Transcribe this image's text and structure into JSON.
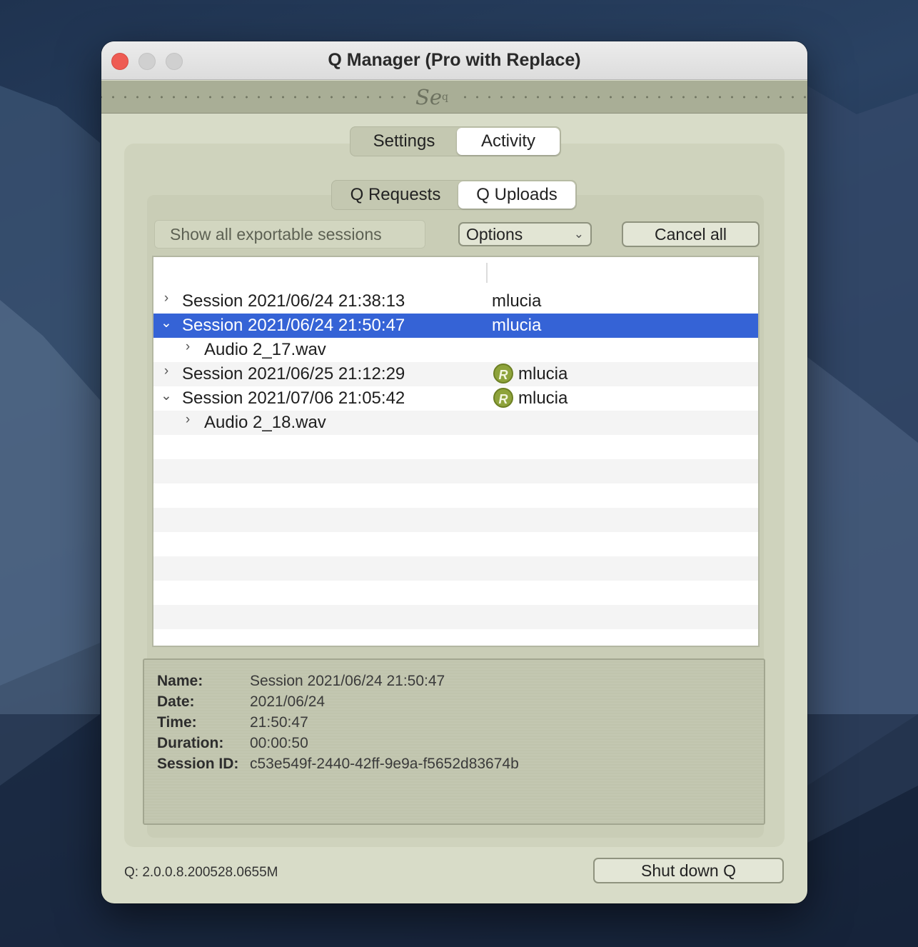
{
  "window": {
    "title": "Q Manager (Pro with Replace)"
  },
  "logo": {
    "main": "Se",
    "sup": "q",
    "icon": "se-q-logo"
  },
  "main_tabs": [
    {
      "label": "Settings",
      "active": false
    },
    {
      "label": "Activity",
      "active": true
    }
  ],
  "sub_tabs": [
    {
      "label": "Q Requests",
      "active": false
    },
    {
      "label": "Q Uploads",
      "active": true
    }
  ],
  "toolbar": {
    "filter_label": "Show all exportable sessions",
    "options_value": "Options",
    "cancel_all": "Cancel all"
  },
  "sessions": [
    {
      "name": "Session 2021/06/24 21:38:13",
      "user": "mlucia",
      "expanded": false,
      "selected": false,
      "replace": false,
      "disclosure": "chevron-right-icon"
    },
    {
      "name": "Session 2021/06/24 21:50:47",
      "user": "mlucia",
      "expanded": true,
      "selected": true,
      "replace": false,
      "disclosure": "chevron-down-icon"
    },
    {
      "name": "Audio 2_17.wav",
      "child": true,
      "disclosure": "chevron-right-icon"
    },
    {
      "name": "Session 2021/06/25 21:12:29",
      "user": "mlucia",
      "expanded": false,
      "selected": false,
      "replace": true,
      "badge": "R",
      "disclosure": "chevron-right-icon"
    },
    {
      "name": "Session 2021/07/06 21:05:42",
      "user": "mlucia",
      "expanded": true,
      "selected": false,
      "replace": true,
      "badge": "R",
      "disclosure": "chevron-down-icon"
    },
    {
      "name": "Audio 2_18.wav",
      "child": true,
      "disclosure": "chevron-right-icon"
    }
  ],
  "details": {
    "name_label": "Name:",
    "name_value": "Session 2021/06/24 21:50:47",
    "date_label": "Date:",
    "date_value": "2021/06/24",
    "time_label": "Time:",
    "time_value": "21:50:47",
    "duration_label": "Duration:",
    "duration_value": "00:00:50",
    "session_id_label": "Session ID:",
    "session_id_value": "c53e549f-2440-42ff-9e9a-f5652d83674b"
  },
  "footer": {
    "version": "Q: 2.0.0.8.200528.0655M",
    "shutdown": "Shut down Q"
  },
  "colors": {
    "selection": "#3563d6",
    "window_bg": "#d8dcc8",
    "replace_badge": "#8ea33b",
    "close_button": "#ee5b53"
  }
}
